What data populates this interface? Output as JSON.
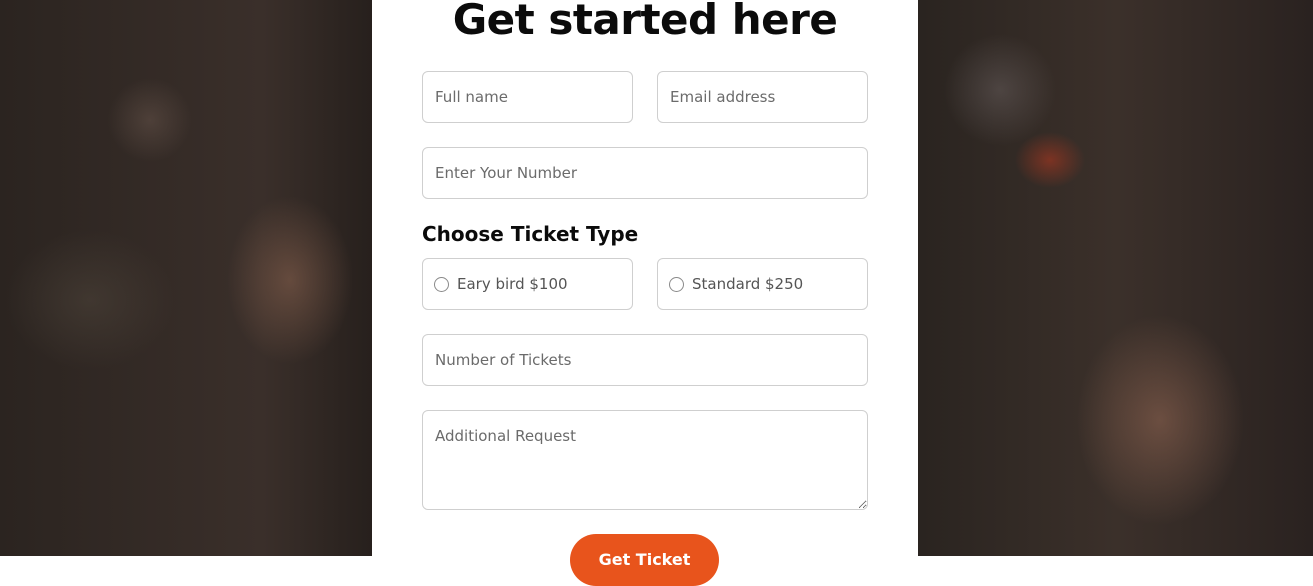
{
  "form": {
    "title": "Get started here",
    "full_name_placeholder": "Full name",
    "email_placeholder": "Email address",
    "phone_placeholder": "Enter Your Number",
    "ticket_type_heading": "Choose Ticket Type",
    "ticket_options": [
      {
        "label": "Eary bird $100"
      },
      {
        "label": "Standard $250"
      }
    ],
    "num_tickets_placeholder": "Number of Tickets",
    "additional_request_placeholder": "Additional Request",
    "submit_label": "Get Ticket"
  },
  "colors": {
    "accent": "#e8541c",
    "card_bg": "#ffffff",
    "border": "#cfcfcf"
  }
}
